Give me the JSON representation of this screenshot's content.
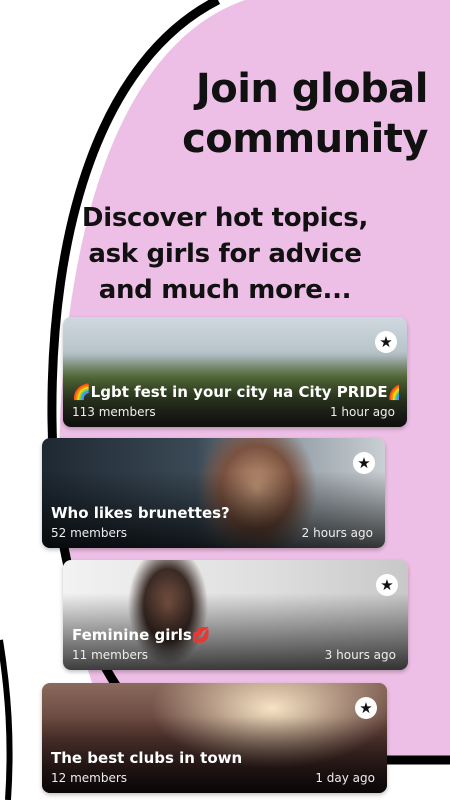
{
  "colors": {
    "blob": "#eebfe6",
    "ring": "#000000",
    "text": "#111111"
  },
  "headline": {
    "line1": "Join global",
    "line2": "community"
  },
  "subheadline": {
    "line1": "Discover hot topics,",
    "line2": "ask girls for advice",
    "line3": "and much more..."
  },
  "cards": [
    {
      "title": "🌈Lgbt fest in your city на City PRIDE🌈",
      "members": "113 members",
      "time": "1 hour ago",
      "icon": "star-icon"
    },
    {
      "title": "Who likes brunettes?",
      "members": "52 members",
      "time": "2 hours ago",
      "icon": "star-icon"
    },
    {
      "title": "Feminine girls💋",
      "members": "11 members",
      "time": "3 hours ago",
      "icon": "star-icon"
    },
    {
      "title": "The best clubs in town",
      "members": "12 members",
      "time": "1 day ago",
      "icon": "star-icon"
    }
  ]
}
